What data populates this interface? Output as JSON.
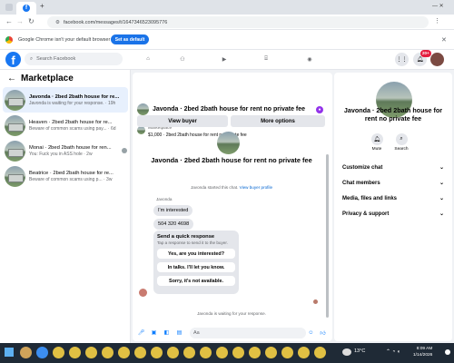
{
  "browser": {
    "tab_favicon": "f",
    "add_tab": "+",
    "url": "facebook.com/messages/t/1647346523095776",
    "infobar_text": "Google Chrome isn't your default browser",
    "infobar_button": "Set as default"
  },
  "header": {
    "logo": "f",
    "search_placeholder": "Search Facebook",
    "notification_count": "20+"
  },
  "sidebar": {
    "title": "Marketplace",
    "conversations": [
      {
        "title": "Javonda · 2bed 2bath house for re...",
        "preview": "Javonda is waiting for your response. · 19h",
        "active": true
      },
      {
        "title": "Heaven · 2bed 2bath house for re...",
        "preview": "Beware of common scams using pay... · 6d",
        "active": false
      },
      {
        "title": "Monai · 2bed 2bath house for ren...",
        "preview": "You: Fuck you in ASS hole · 2w",
        "active": false
      },
      {
        "title": "Beatrice · 2bed 2bath house for re...",
        "preview": "Beware of common scams using p... · 3w",
        "active": false
      }
    ]
  },
  "chat": {
    "header_title": "Javonda · 2bed 2bath house for rent no private fee",
    "marketplace_label": "Marketplace",
    "listing_line": "$1,000 · 2bed 2bath house for rent no private fee",
    "view_buyer": "View buyer",
    "more_options": "More options",
    "hero_title": "Javonda · 2bed 2bath house for rent no private fee",
    "started_text": "Javonda started this chat.",
    "started_link": "View buyer profile",
    "sender_name": "Javonda",
    "messages": [
      "I'm interested",
      "504 320 4698"
    ],
    "quick_title": "Send a quick response",
    "quick_sub": "Tap a response to send it to the buyer.",
    "quick_options": [
      "Yes, are you interested?",
      "In talks. I'll let you know.",
      "Sorry, it's not available."
    ],
    "waiting_text": "Javonda is waiting for your response.",
    "composer_placeholder": "Aa"
  },
  "details": {
    "title": "Javonda · 2bed 2bath house for rent no private fee",
    "actions": [
      {
        "label": "Mute",
        "icon": "bell-icon"
      },
      {
        "label": "Search",
        "icon": "search-icon"
      }
    ],
    "sections": [
      "Customize chat",
      "Chat members",
      "Media, files and links",
      "Privacy & support"
    ]
  },
  "taskbar": {
    "weather": "13°C",
    "time": "8:09 AM",
    "date": "1/14/2026"
  },
  "colors": {
    "brand": "#1877f2",
    "accent": "#0a7cff",
    "badge": "#e41e3f"
  }
}
